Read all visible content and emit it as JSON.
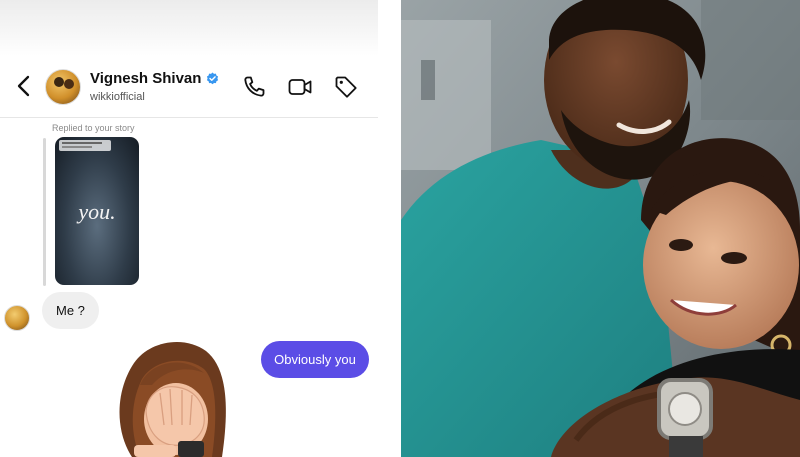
{
  "contact": {
    "name": "Vignesh Shivan",
    "handle": "wikkiofficial",
    "verified": true
  },
  "header_icons": [
    "back-chevron-icon",
    "phone-icon",
    "video-call-icon",
    "tag-icon"
  ],
  "story_reply": {
    "label": "Replied to your story",
    "story_text": "you."
  },
  "messages": [
    {
      "direction": "incoming",
      "text": "Me ?"
    },
    {
      "direction": "outgoing",
      "text": "Obviously you"
    }
  ],
  "sticker": "facepalm-memoji",
  "colors": {
    "outgoing_bubble": "#5b4de6",
    "incoming_bubble": "#efefef",
    "verified_badge": "#3897f0"
  },
  "photo": {
    "description_icon": "couple-photo"
  }
}
